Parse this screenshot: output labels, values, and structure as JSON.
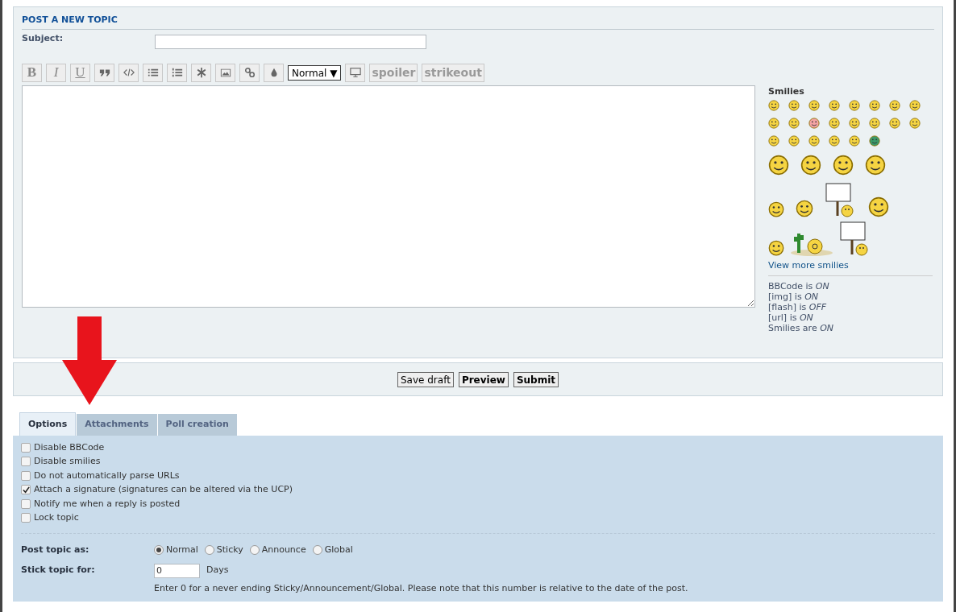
{
  "post_panel": {
    "heading": "POST A NEW TOPIC",
    "subject_label": "Subject:",
    "toolbar": [
      {
        "kind": "bold",
        "label": "B"
      },
      {
        "kind": "italic",
        "label": "I"
      },
      {
        "kind": "underline",
        "label": "U"
      },
      {
        "kind": "quote"
      },
      {
        "kind": "code"
      },
      {
        "kind": "list"
      },
      {
        "kind": "numlist"
      },
      {
        "kind": "star"
      },
      {
        "kind": "image"
      },
      {
        "kind": "link"
      },
      {
        "kind": "drop"
      },
      {
        "kind": "select",
        "label": "Normal ▼"
      },
      {
        "kind": "monitor"
      },
      {
        "kind": "word",
        "label": "spoiler"
      },
      {
        "kind": "word",
        "label": "strikeout"
      }
    ],
    "smilies": {
      "title": "Smilies",
      "more_link": "View more smilies",
      "status": [
        "BBCode is *ON*",
        "[img] is *ON*",
        "[flash] is *OFF*",
        "[url] is *ON*",
        "Smilies are *ON*"
      ]
    }
  },
  "buttons": [
    {
      "label": "Save draft",
      "primary": false
    },
    {
      "label": "Preview",
      "primary": true
    },
    {
      "label": "Submit",
      "primary": true
    }
  ],
  "tabs": [
    {
      "label": "Options",
      "selected": true
    },
    {
      "label": "Attachments",
      "selected": false
    },
    {
      "label": "Poll creation",
      "selected": false
    }
  ],
  "options": [
    {
      "label": "Disable BBCode",
      "checked": false
    },
    {
      "label": "Disable smilies",
      "checked": false
    },
    {
      "label": "Do not automatically parse URLs",
      "checked": false
    },
    {
      "label": "Attach a signature (signatures can be altered via the UCP)",
      "checked": true
    },
    {
      "label": "Notify me when a reply is posted",
      "checked": false
    },
    {
      "label": "Lock topic",
      "checked": false
    }
  ],
  "post_as": {
    "label": "Post topic as:",
    "choices": [
      {
        "label": "Normal",
        "selected": true
      },
      {
        "label": "Sticky",
        "selected": false
      },
      {
        "label": "Announce",
        "selected": false
      },
      {
        "label": "Global",
        "selected": false
      }
    ]
  },
  "stick_for": {
    "label": "Stick topic for:",
    "value": "0",
    "unit": "Days",
    "hint": "Enter 0 for a never ending Sticky/Announcement/Global. Please note that this number is relative to the date of the post."
  }
}
